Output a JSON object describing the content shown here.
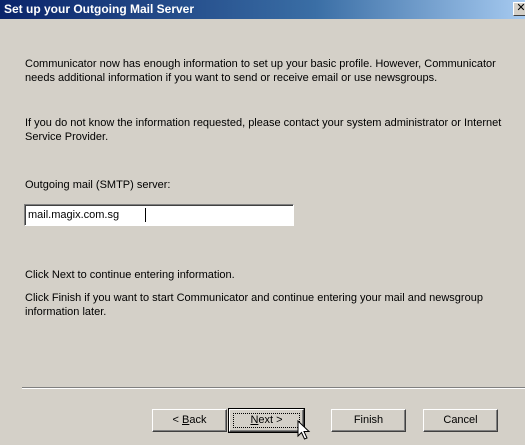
{
  "window": {
    "title": "Set up your Outgoing Mail Server",
    "close_glyph": "✕"
  },
  "content": {
    "paragraph1": "Communicator now has enough information to set up your basic profile. However, Communicator needs additional information if you want to send or receive email or use newsgroups.",
    "paragraph2": "If you do not know the information requested, please contact your system administrator or Internet Service Provider.",
    "smtp_label": "Outgoing mail (SMTP) server:",
    "smtp_value": "mail.magix.com.sg",
    "paragraph3": "Click Next to continue entering information.",
    "paragraph4": "Click Finish if you want to start Communicator and continue entering your mail and newsgroup information later."
  },
  "buttons": {
    "back_prefix": "< ",
    "back_mnemonic": "B",
    "back_rest": "ack",
    "next_mnemonic": "N",
    "next_rest": "ext >",
    "finish": "Finish",
    "cancel": "Cancel"
  },
  "icons": {
    "close": "close-icon",
    "cursor": "mouse-pointer-icon"
  }
}
